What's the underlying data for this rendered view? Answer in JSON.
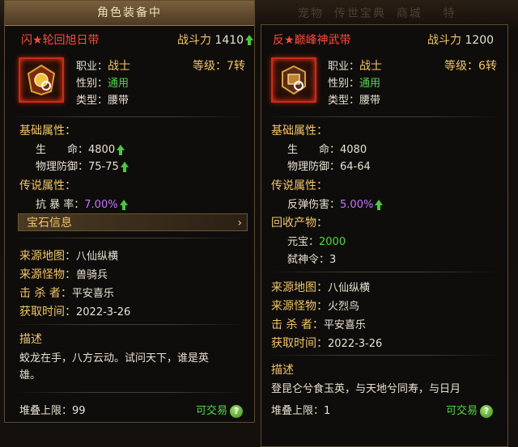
{
  "window_title": "角色装备中",
  "background_menu": [
    "宠物",
    "传世宝典",
    "商城",
    "特"
  ],
  "left": {
    "name": "闪★轮回旭日带",
    "power_label": "战斗力",
    "power_value": "1410",
    "job_label": "职业：",
    "job_value": "战士",
    "gender_label": "性别：",
    "gender_value": "通用",
    "type_label": "类型：",
    "type_value": "腰带",
    "level_label": "等级：",
    "level_value": "7转",
    "base_title": "基础属性：",
    "hp_label": "生　　命：",
    "hp_value": "4800",
    "def_label": "物理防御：",
    "def_value": "75-75",
    "legend_title": "传说属性：",
    "crit_label": "抗 暴 率：",
    "crit_value": "7.00%",
    "gem_info": "宝石信息",
    "src_map_label": "来源地图：",
    "src_map_value": "八仙纵横",
    "src_mon_label": "来源怪物：",
    "src_mon_value": "兽骑兵",
    "killer_label": "击 杀 者：",
    "killer_value": "平安喜乐",
    "time_label": "获取时间：",
    "time_value": "2022-3-26",
    "desc_title": "描述",
    "desc_line1": "蛟龙在手，八方云动。试问天下，谁是英",
    "desc_line2": "雄。",
    "stack_label": "堆叠上限：",
    "stack_value": "99",
    "trade": "可交易"
  },
  "right": {
    "name": "反★巅峰神武带",
    "power_label": "战斗力",
    "power_value": "1200",
    "job_label": "职业：",
    "job_value": "战士",
    "gender_label": "性别：",
    "gender_value": "通用",
    "type_label": "类型：",
    "type_value": "腰带",
    "level_label": "等级：",
    "level_value": "6转",
    "base_title": "基础属性：",
    "hp_label": "生　　命：",
    "hp_value": "4080",
    "def_label": "物理防御：",
    "def_value": "64-64",
    "legend_title": "传说属性：",
    "reflect_label": "反弹伤害：",
    "reflect_value": "5.00%",
    "recycle_title": "回收产物：",
    "yuanbao_label": "元宝：",
    "yuanbao_value": "2000",
    "shenling_label": "弑神令：",
    "shenling_value": "3",
    "src_map_label": "来源地图：",
    "src_map_value": "八仙纵横",
    "src_mon_label": "来源怪物：",
    "src_mon_value": "火烈鸟",
    "killer_label": "击 杀 者：",
    "killer_value": "平安喜乐",
    "time_label": "获取时间：",
    "time_value": "2022-3-26",
    "desc_title": "描述",
    "desc_line1": "登昆仑兮食玉英，与天地兮同寿，与日月",
    "stack_label": "堆叠上限：",
    "stack_value": "1",
    "trade": "可交易"
  },
  "colors": {
    "red_name": "#ff4a3a",
    "gold": "#f0c56a",
    "green": "#52d64a",
    "purple": "#c276ff"
  },
  "icons": [
    "belt-item-icon",
    "arrow-up-icon",
    "question-icon",
    "chevron-right-icon"
  ]
}
